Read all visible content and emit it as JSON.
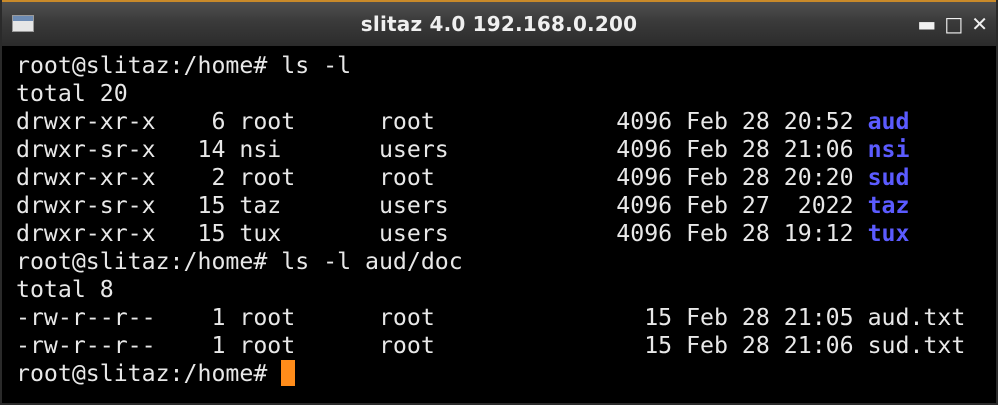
{
  "window": {
    "title": "slitaz 4.0 192.168.0.200",
    "controls": {
      "minimize": "▬",
      "maximize": "□",
      "close": "✕"
    }
  },
  "terminal": {
    "lines": [
      {
        "text": "root@slitaz:/home# ls -l"
      },
      {
        "text": "total 20"
      },
      {
        "text": "drwxr-xr-x    6 root      root             4096 Feb 28 20:52 ",
        "name": "aud"
      },
      {
        "text": "drwxr-sr-x   14 nsi       users            4096 Feb 28 21:06 ",
        "name": "nsi"
      },
      {
        "text": "drwxr-xr-x    2 root      root             4096 Feb 28 20:20 ",
        "name": "sud"
      },
      {
        "text": "drwxr-sr-x   15 taz       users            4096 Feb 27  2022 ",
        "name": "taz"
      },
      {
        "text": "drwxr-xr-x   15 tux       users            4096 Feb 28 19:12 ",
        "name": "tux"
      },
      {
        "text": "root@slitaz:/home# ls -l aud/doc"
      },
      {
        "text": "total 8"
      },
      {
        "text": "-rw-r--r--    1 root      root               15 Feb 28 21:05 aud.txt"
      },
      {
        "text": "-rw-r--r--    1 root      root               15 Feb 28 21:06 sud.txt"
      },
      {
        "text": "root@slitaz:/home# "
      }
    ],
    "colors": {
      "background": "#000000",
      "foreground": "#e8e8e8",
      "directory": "#5b5bff",
      "cursor": "#ff8c1a"
    }
  }
}
